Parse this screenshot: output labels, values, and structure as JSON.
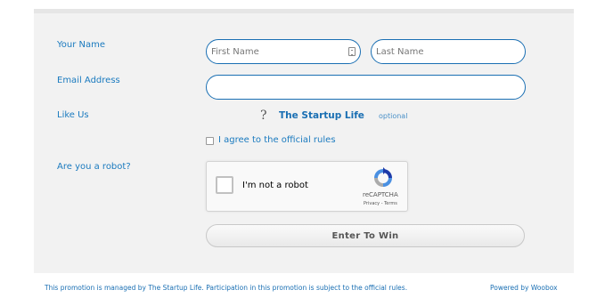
{
  "form": {
    "name_label": "Your Name",
    "first_name_placeholder": "First Name",
    "last_name_placeholder": "Last Name",
    "email_label": "Email Address",
    "email_value": "",
    "like_label": "Like Us",
    "like_icon": "question-mark-icon",
    "like_page_name": "The Startup Life",
    "like_optional": "optional",
    "agree_text": "I agree to the official rules",
    "robot_label": "Are you a robot?",
    "submit_label": "Enter To Win"
  },
  "captcha": {
    "text": "I'm not a robot",
    "brand": "reCAPTCHA",
    "links": "Privacy - Terms"
  },
  "footer": {
    "promo_text": "This promotion is managed by The Startup Life. Participation in this promotion is subject to the official rules.",
    "powered_by": "Powered by Woobox"
  },
  "colors": {
    "accent_blue": "#1a7abf",
    "field_border": "#1a6fb3",
    "panel_bg": "#f2f2f2"
  }
}
